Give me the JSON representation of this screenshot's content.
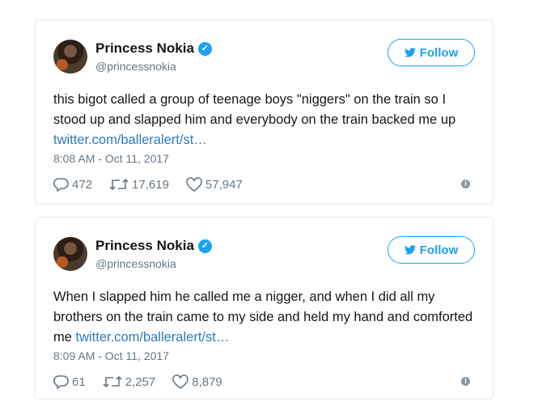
{
  "tweets": [
    {
      "author": {
        "name": "Princess Nokia",
        "handle": "@princessnokia",
        "verified": true,
        "avatar_icon": "avatar-photo"
      },
      "follow_label": "Follow",
      "text": "this bigot called a group of teenage boys \"niggers\" on the train so I stood up and slapped him and everybody on the train backed me up ",
      "link": "twitter.com/balleralert/st…",
      "timestamp": "8:08 AM - Oct 11, 2017",
      "replies": "472",
      "retweets": "17,619",
      "likes": "57,947"
    },
    {
      "author": {
        "name": "Princess Nokia",
        "handle": "@princessnokia",
        "verified": true,
        "avatar_icon": "avatar-photo"
      },
      "follow_label": "Follow",
      "text": "When I slapped him he called me a nigger, and when I did all my brothers on the train came to my side and held my hand and comforted me ",
      "link": "twitter.com/balleralert/st…",
      "timestamp": "8:09 AM - Oct 11, 2017",
      "replies": "61",
      "retweets": "2,257",
      "likes": "8,879"
    }
  ],
  "colors": {
    "accent": "#1da1f2",
    "link": "#2b7bb9",
    "muted": "#657786",
    "border": "#e1e8ed"
  }
}
